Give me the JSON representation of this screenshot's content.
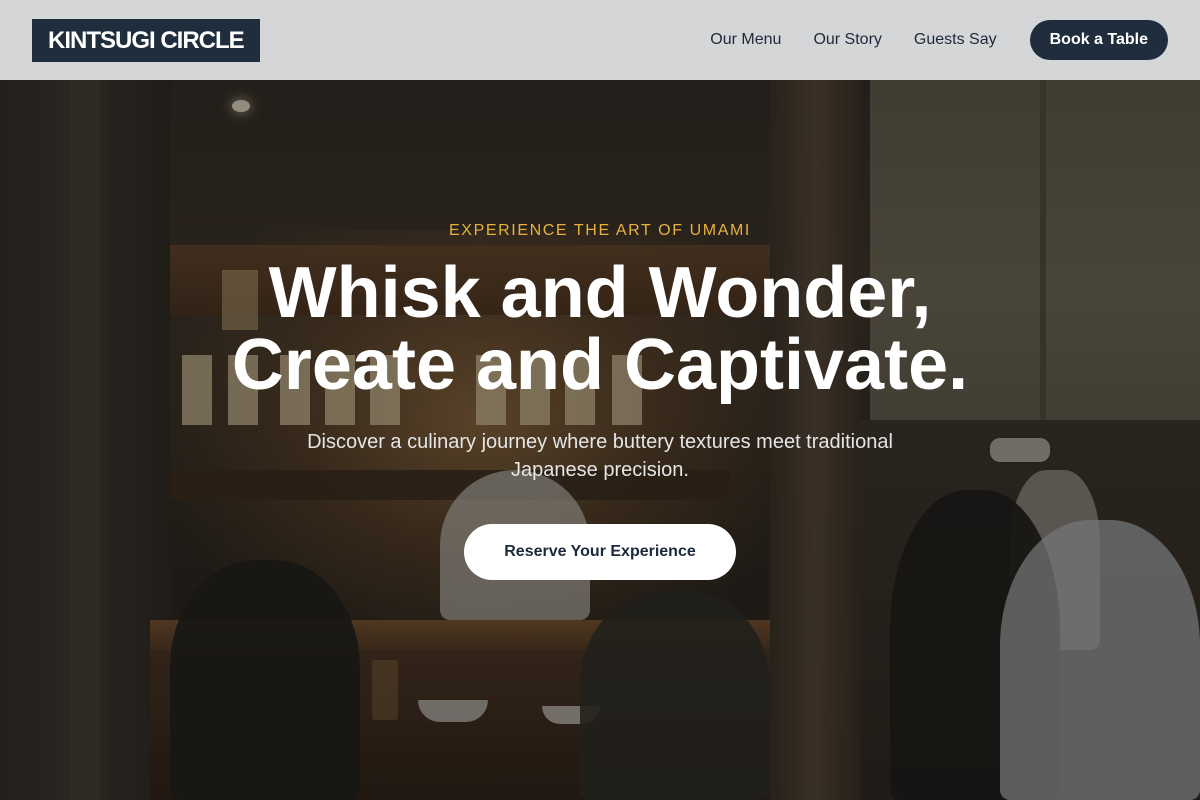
{
  "brand": {
    "logo_text": "KINTSUGI CIRCLE"
  },
  "nav": {
    "links": [
      {
        "label": "Our Menu"
      },
      {
        "label": "Our Story"
      },
      {
        "label": "Guests Say"
      }
    ],
    "cta_label": "Book a Table"
  },
  "hero": {
    "eyebrow": "EXPERIENCE THE ART OF UMAMI",
    "headline_line1": "Whisk and Wonder,",
    "headline_line2": "Create and Captivate.",
    "subheadline": "Discover a culinary journey where buttery textures meet traditional Japanese precision.",
    "cta_label": "Reserve Your Experience"
  },
  "colors": {
    "accent_gold": "#e8b13a",
    "brand_navy": "#1f2d3d",
    "nav_background": "#e2e4e6",
    "cta_background": "#ffffff"
  }
}
